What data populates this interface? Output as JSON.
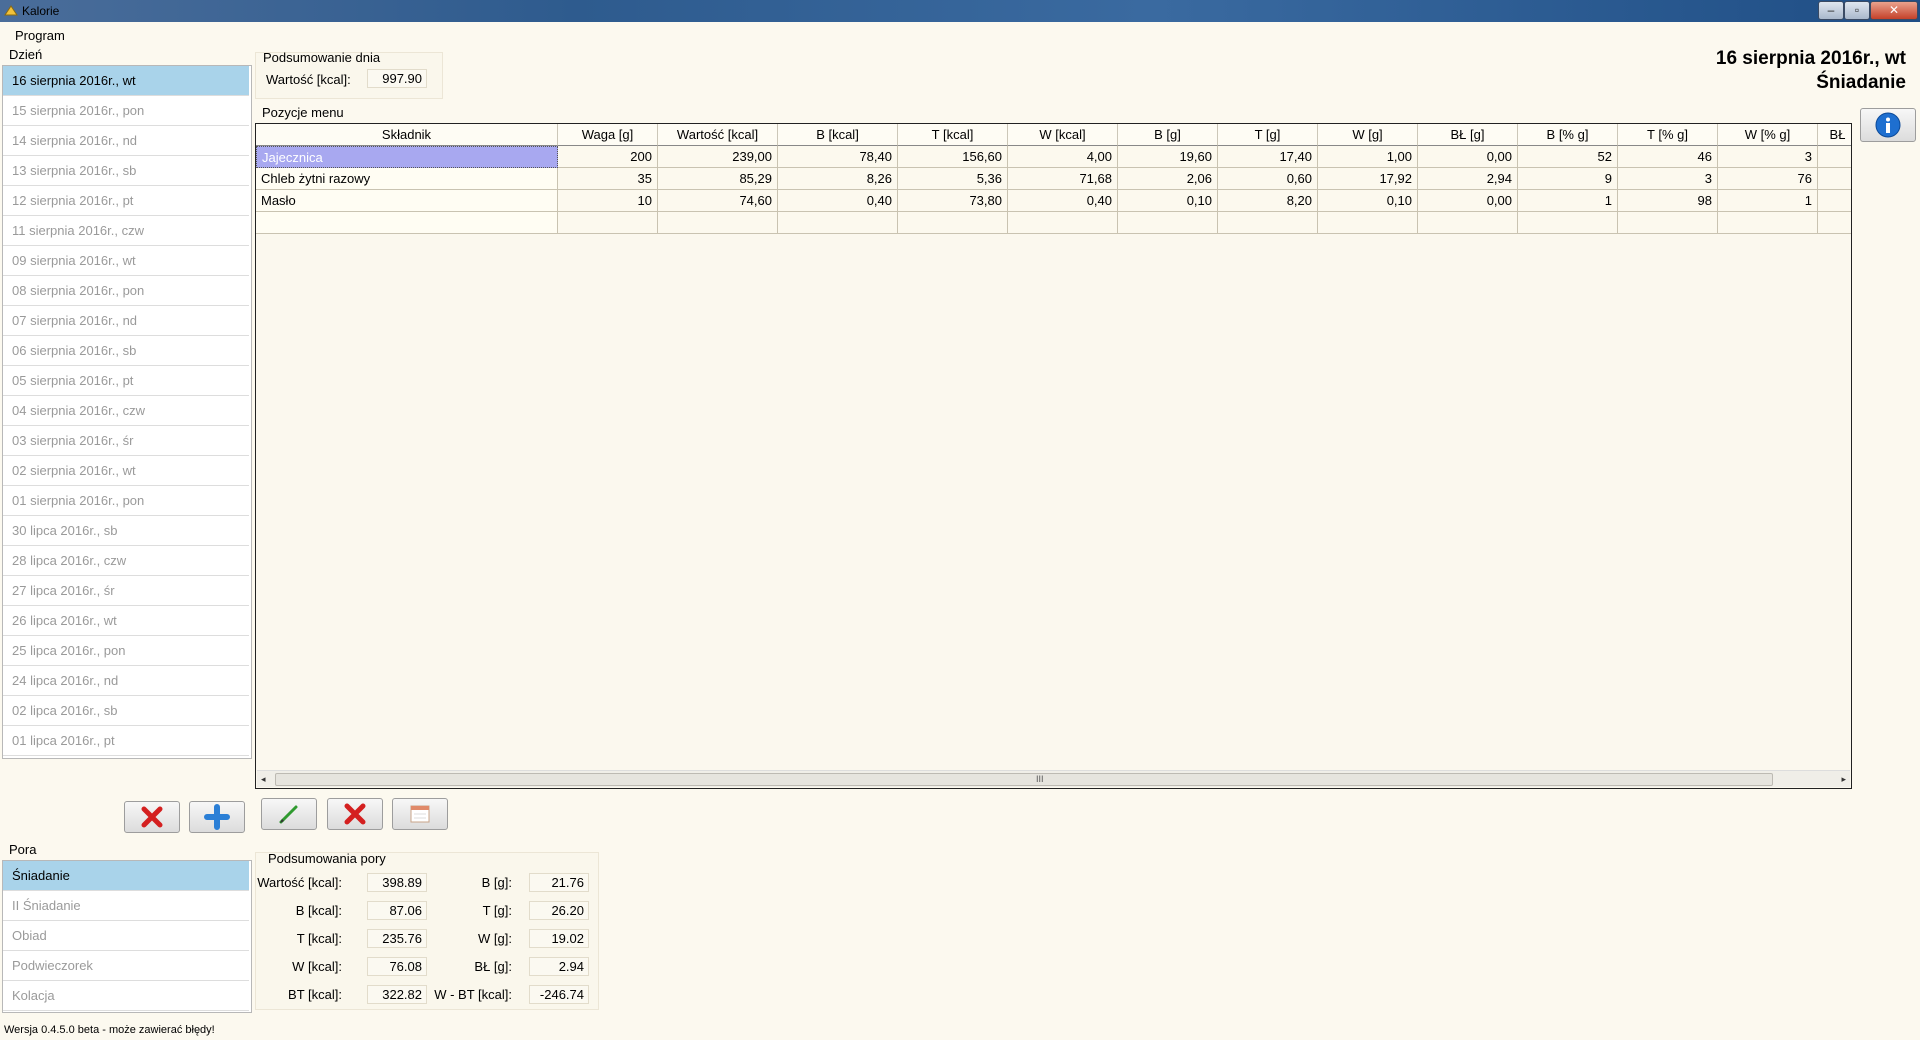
{
  "window": {
    "title": "Kalorie",
    "min_label": "–",
    "max_label": "▫",
    "close_label": "✕"
  },
  "menu": {
    "program": "Program"
  },
  "days": {
    "label": "Dzień",
    "items": [
      "16 sierpnia 2016r., wt",
      "15 sierpnia 2016r., pon",
      "14 sierpnia 2016r., nd",
      "13 sierpnia 2016r., sb",
      "12 sierpnia 2016r., pt",
      "11 sierpnia 2016r., czw",
      "09 sierpnia 2016r., wt",
      "08 sierpnia 2016r., pon",
      "07 sierpnia 2016r., nd",
      "06 sierpnia 2016r., sb",
      "05 sierpnia 2016r., pt",
      "04 sierpnia 2016r., czw",
      "03 sierpnia 2016r., śr",
      "02 sierpnia 2016r., wt",
      "01 sierpnia 2016r., pon",
      "30 lipca 2016r., sb",
      "28 lipca 2016r., czw",
      "27 lipca 2016r., śr",
      "26 lipca 2016r., wt",
      "25 lipca 2016r., pon",
      "24 lipca 2016r., nd",
      "02 lipca 2016r., sb",
      "01 lipca 2016r., pt"
    ],
    "selected_index": 0
  },
  "day_summary": {
    "title": "Podsumowanie dnia",
    "value_label": "Wartość [kcal]:",
    "value": "997.90"
  },
  "header": {
    "date": "16 sierpnia 2016r., wt",
    "meal": "Śniadanie"
  },
  "menu_items": {
    "title": "Pozycje menu",
    "columns": [
      "Składnik",
      "Waga [g]",
      "Wartość [kcal]",
      "B [kcal]",
      "T [kcal]",
      "W [kcal]",
      "B [g]",
      "T [g]",
      "W [g]",
      "BŁ [g]",
      "B [% g]",
      "T [% g]",
      "W [% g]",
      "BŁ"
    ],
    "rows": [
      [
        "Jajecznica",
        "200",
        "239,00",
        "78,40",
        "156,60",
        "4,00",
        "19,60",
        "17,40",
        "1,00",
        "0,00",
        "52",
        "46",
        "3",
        ""
      ],
      [
        "Chleb żytni razowy",
        "35",
        "85,29",
        "8,26",
        "5,36",
        "71,68",
        "2,06",
        "0,60",
        "17,92",
        "2,94",
        "9",
        "3",
        "76",
        ""
      ],
      [
        "Masło",
        "10",
        "74,60",
        "0,40",
        "73,80",
        "0,40",
        "0,10",
        "8,20",
        "0,10",
        "0,00",
        "1",
        "98",
        "1",
        ""
      ],
      [
        "",
        "",
        "",
        "",
        "",
        "",
        "",
        "",
        "",
        "",
        "",
        "",
        "",
        ""
      ]
    ],
    "scroll_grip": "III"
  },
  "meals": {
    "label": "Pora",
    "items": [
      "Śniadanie",
      "II Śniadanie",
      "Obiad",
      "Podwieczorek",
      "Kolacja"
    ],
    "selected_index": 0
  },
  "meal_summary": {
    "title": "Podsumowania pory",
    "left": [
      {
        "label": "Wartość [kcal]:",
        "value": "398.89"
      },
      {
        "label": "B [kcal]:",
        "value": "87.06"
      },
      {
        "label": "T [kcal]:",
        "value": "235.76"
      },
      {
        "label": "W [kcal]:",
        "value": "76.08"
      },
      {
        "label": "BT [kcal]:",
        "value": "322.82"
      }
    ],
    "right": [
      {
        "label": "B [g]:",
        "value": "21.76"
      },
      {
        "label": "T [g]:",
        "value": "26.20"
      },
      {
        "label": "W [g]:",
        "value": "19.02"
      },
      {
        "label": "BŁ [g]:",
        "value": "2.94"
      },
      {
        "label": "W - BT [kcal]:",
        "value": "-246.74"
      }
    ]
  },
  "footer": {
    "version": "Wersja 0.4.5.0 beta - może zawierać błędy!"
  },
  "icons": {
    "delete": "delete-icon",
    "add": "plus-icon",
    "edit": "pencil-icon",
    "calendar": "calendar-icon",
    "info": "info-icon"
  },
  "colors": {
    "selected_bg": "#a9d3ea",
    "grid_selected": "#a8a8f0",
    "delete_red": "#d42020",
    "add_blue": "#2b7fd6"
  }
}
